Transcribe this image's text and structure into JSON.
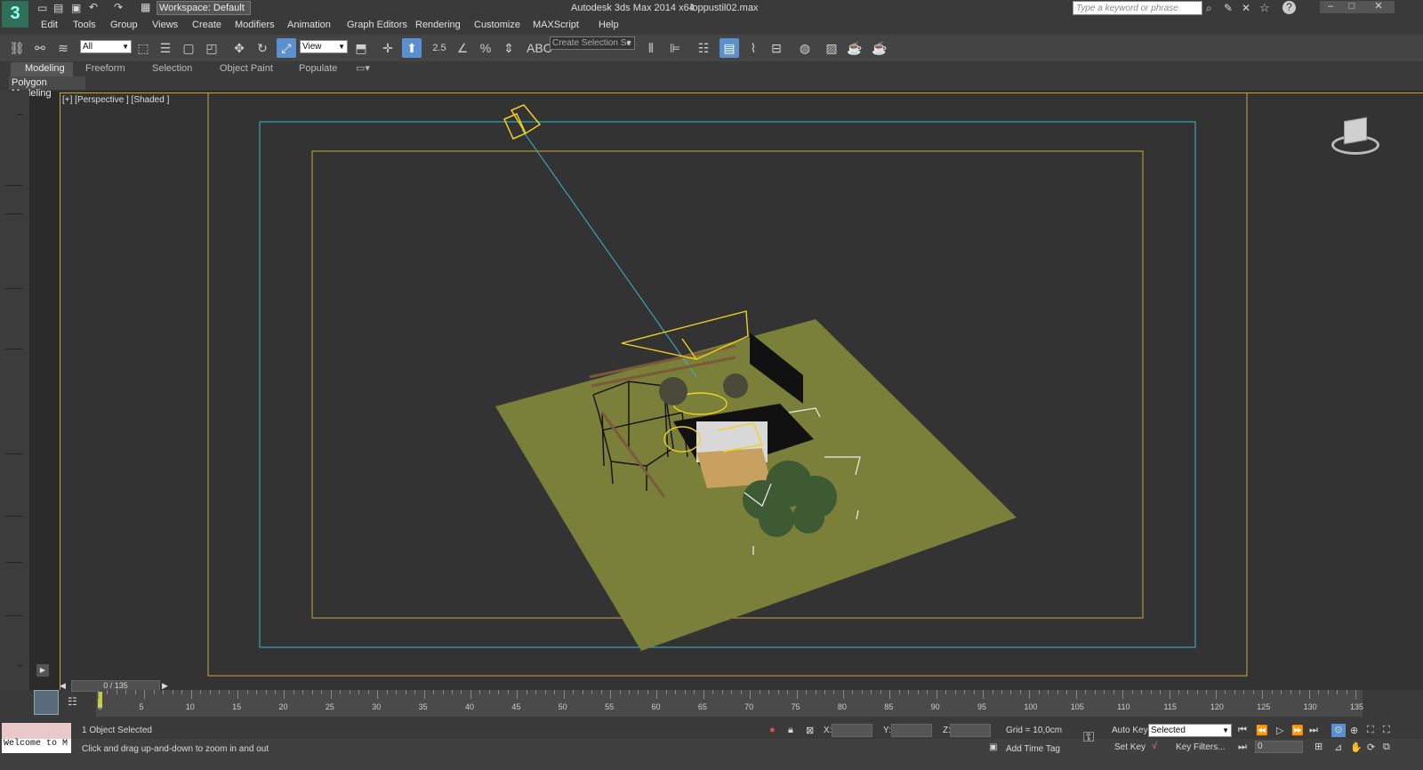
{
  "title_bar": {
    "workspace": "Workspace: Default",
    "app_title": "Autodesk 3ds Max  2014 x64",
    "file_name": "loppustil02.max",
    "search_placeholder": "Type a keyword or phrase"
  },
  "menu": [
    "Edit",
    "Tools",
    "Group",
    "Views",
    "Create",
    "Modifiers",
    "Animation",
    "Graph Editors",
    "Rendering",
    "Customize",
    "MAXScript",
    "Help"
  ],
  "toolbar": {
    "selection_filter": "All",
    "reference_coord": "View",
    "snap_label": "2.5",
    "named_selection_placeholder": "Create Selection Se"
  },
  "ribbon": {
    "tabs": [
      "Modeling",
      "Freeform",
      "Selection",
      "Object Paint",
      "Populate"
    ],
    "active_tab": "Modeling",
    "panel_label": "Polygon Modeling"
  },
  "viewport": {
    "label": "[+] [Perspective ] [Shaded ]"
  },
  "timeline": {
    "frame_counter": "0 / 135",
    "ticks": [
      "0",
      "5",
      "10",
      "15",
      "20",
      "25",
      "30",
      "35",
      "40",
      "45",
      "50",
      "55",
      "60",
      "65",
      "70",
      "75",
      "80",
      "85",
      "90",
      "95",
      "100",
      "105",
      "110",
      "115",
      "120",
      "125",
      "130",
      "135"
    ]
  },
  "status": {
    "maxscript_listener": "Welcome to M",
    "selection_info": "1 Object Selected",
    "prompt": "Click and drag up-and-down to zoom in and out",
    "x_label": "X:",
    "y_label": "Y:",
    "z_label": "Z:",
    "grid": "Grid = 10,0cm",
    "add_time_tag": "Add Time Tag",
    "auto_key": "Auto Key",
    "set_key": "Set Key",
    "key_mode": "Selected",
    "key_filters": "Key Filters...",
    "current_frame": "0"
  },
  "colors": {
    "ground": "#7a7f3a",
    "safe_frame_outer": "#c9a83a",
    "safe_frame_action": "#3ab8c8",
    "selection_wire": "#f0d020",
    "accent": "#5a8fd0"
  }
}
